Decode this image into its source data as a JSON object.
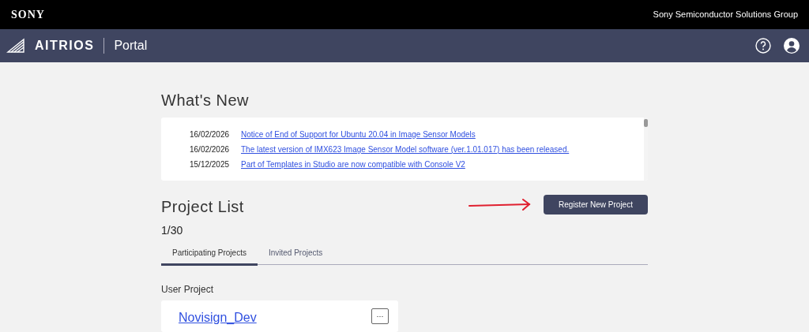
{
  "top_bar": {
    "brand": "SONY",
    "group": "Sony Semiconductor Solutions Group"
  },
  "header": {
    "product": "AITRIOS",
    "section": "Portal"
  },
  "whats_new": {
    "title": "What's New",
    "items": [
      {
        "date": "16/02/2026",
        "title": "Notice of End of Support for Ubuntu 20.04 in Image Sensor Models"
      },
      {
        "date": "16/02/2026",
        "title": "The latest version of IMX623 Image Sensor Model software (ver.1.01.017) has been released."
      },
      {
        "date": "15/12/2025",
        "title": "Part of Templates in Studio are now compatible with Console V2"
      }
    ]
  },
  "project_list": {
    "title": "Project List",
    "register_button": "Register New Project",
    "count": "1/30",
    "tabs": [
      {
        "label": "Participating Projects",
        "selected": true
      },
      {
        "label": "Invited Projects",
        "selected": false
      }
    ],
    "group_title": "User Project",
    "projects": [
      {
        "name": "Novisign_Dev",
        "menu": "···"
      }
    ]
  }
}
